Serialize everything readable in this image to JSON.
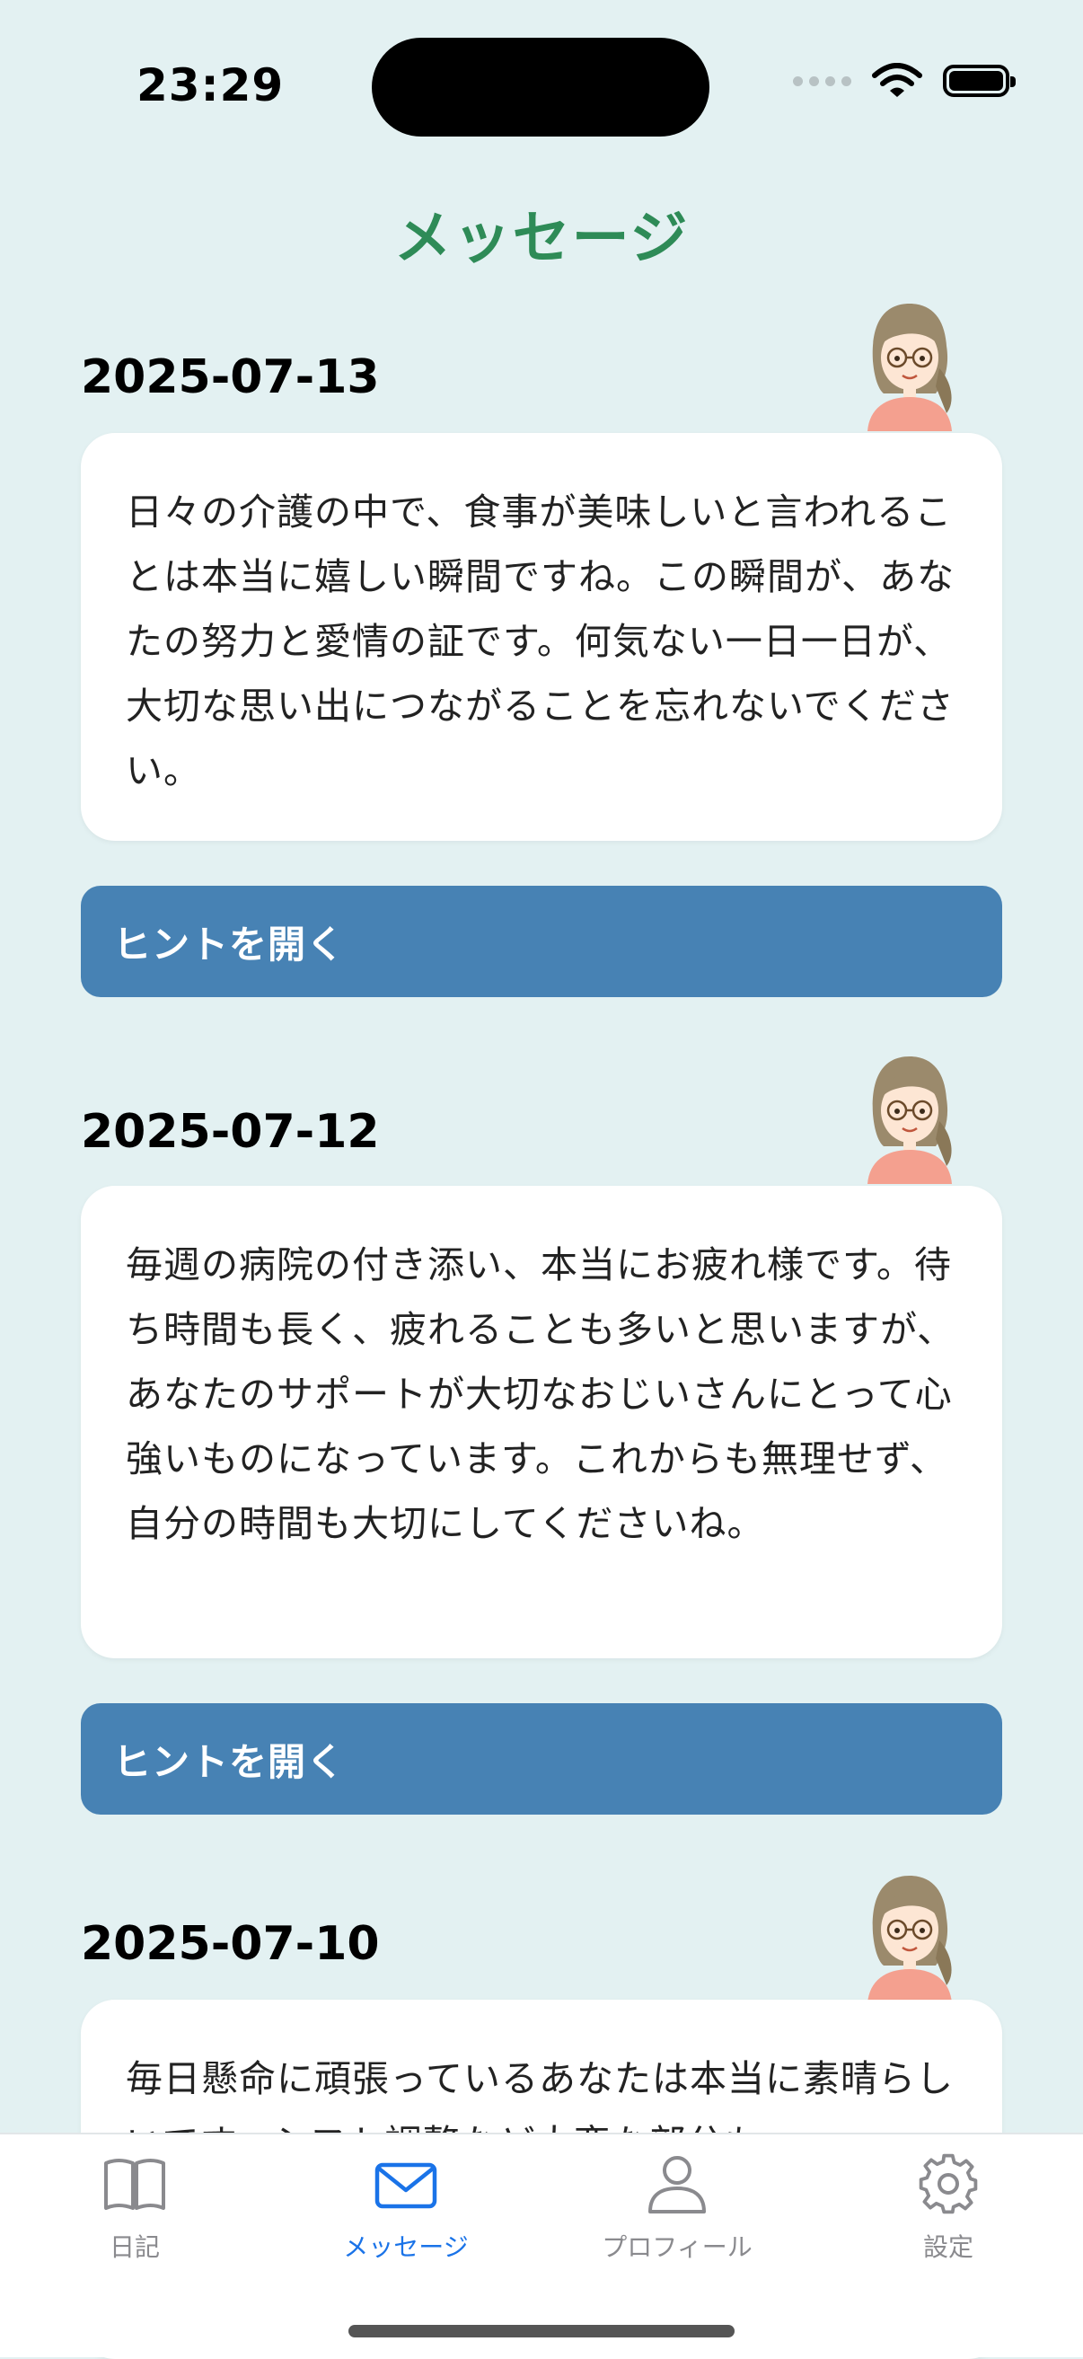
{
  "status": {
    "time": "23:29"
  },
  "header": {
    "title": "メッセージ"
  },
  "entries": [
    {
      "date": "2025-07-13",
      "message": "日々の介護の中で、食事が美味しいと言われることは本当に嬉しい瞬間ですね。この瞬間が、あなたの努力と愛情の証です。何気ない一日一日が、大切な思い出につながることを忘れないでください。",
      "hint_label": "ヒントを開く"
    },
    {
      "date": "2025-07-12",
      "message": "毎週の病院の付き添い、本当にお疲れ様です。待ち時間も長く、疲れることも多いと思いますが、あなたのサポートが大切なおじいさんにとって心強いものになっています。これからも無理せず、自分の時間も大切にしてくださいね。",
      "hint_label": "ヒントを開く"
    },
    {
      "date": "2025-07-10",
      "message": "毎日懸命に頑張っているあなたは本当に素晴らしいです。シフト調整など大変な部分も",
      "hint_label": ""
    }
  ],
  "tabbar": {
    "items": [
      {
        "label": "日記",
        "icon": "book-icon",
        "active": false
      },
      {
        "label": "メッセージ",
        "icon": "envelope-icon",
        "active": true
      },
      {
        "label": "プロフィール",
        "icon": "person-icon",
        "active": false
      },
      {
        "label": "設定",
        "icon": "gear-icon",
        "active": false
      }
    ]
  },
  "colors": {
    "background": "#e3f1f2",
    "title": "#2e8b57",
    "hint_button": "#4782b4",
    "tab_active": "#1a73e8",
    "tab_inactive": "#8a8a8e"
  }
}
